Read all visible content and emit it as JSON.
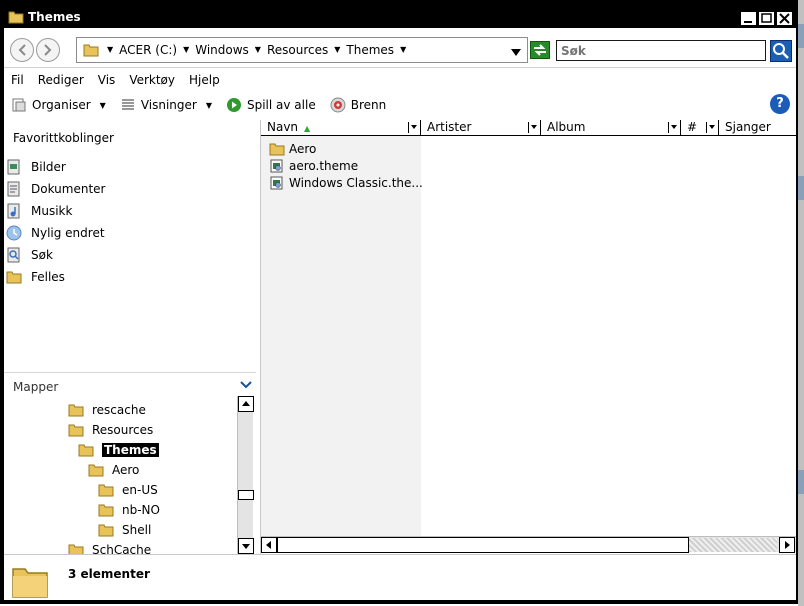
{
  "window": {
    "title": "Themes"
  },
  "address": {
    "crumbs": [
      "ACER (C:)",
      "Windows",
      "Resources",
      "Themes"
    ],
    "search_placeholder": "Søk"
  },
  "menu": [
    "Fil",
    "Rediger",
    "Vis",
    "Verktøy",
    "Hjelp"
  ],
  "toolbar": {
    "organize": "Organiser",
    "views": "Visninger",
    "play_all": "Spill av alle",
    "burn": "Brenn",
    "help": "?"
  },
  "favorites": {
    "heading": "Favorittkoblinger",
    "items": [
      "Bilder",
      "Dokumenter",
      "Musikk",
      "Nylig endret",
      "Søk",
      "Felles"
    ]
  },
  "folders": {
    "heading": "Mapper",
    "tree": [
      {
        "label": "rescache",
        "selected": false
      },
      {
        "label": "Resources",
        "selected": false
      },
      {
        "label": "Themes",
        "selected": true
      },
      {
        "label": "Aero",
        "selected": false
      },
      {
        "label": "en-US",
        "selected": false
      },
      {
        "label": "nb-NO",
        "selected": false
      },
      {
        "label": "Shell",
        "selected": false
      },
      {
        "label": "SchCache",
        "selected": false
      }
    ]
  },
  "columns": [
    "Navn",
    "Artister",
    "Album",
    "#",
    "Sjanger"
  ],
  "files": [
    {
      "name": "Aero",
      "type": "folder"
    },
    {
      "name": "aero.theme",
      "type": "theme"
    },
    {
      "name": "Windows Classic.the...",
      "type": "theme"
    }
  ],
  "status": {
    "count": "3 elementer"
  },
  "colors": {
    "titlebar": "#000000",
    "search_text": "#2aa82a",
    "selection": "#000000",
    "folder": "#e8c35a"
  }
}
